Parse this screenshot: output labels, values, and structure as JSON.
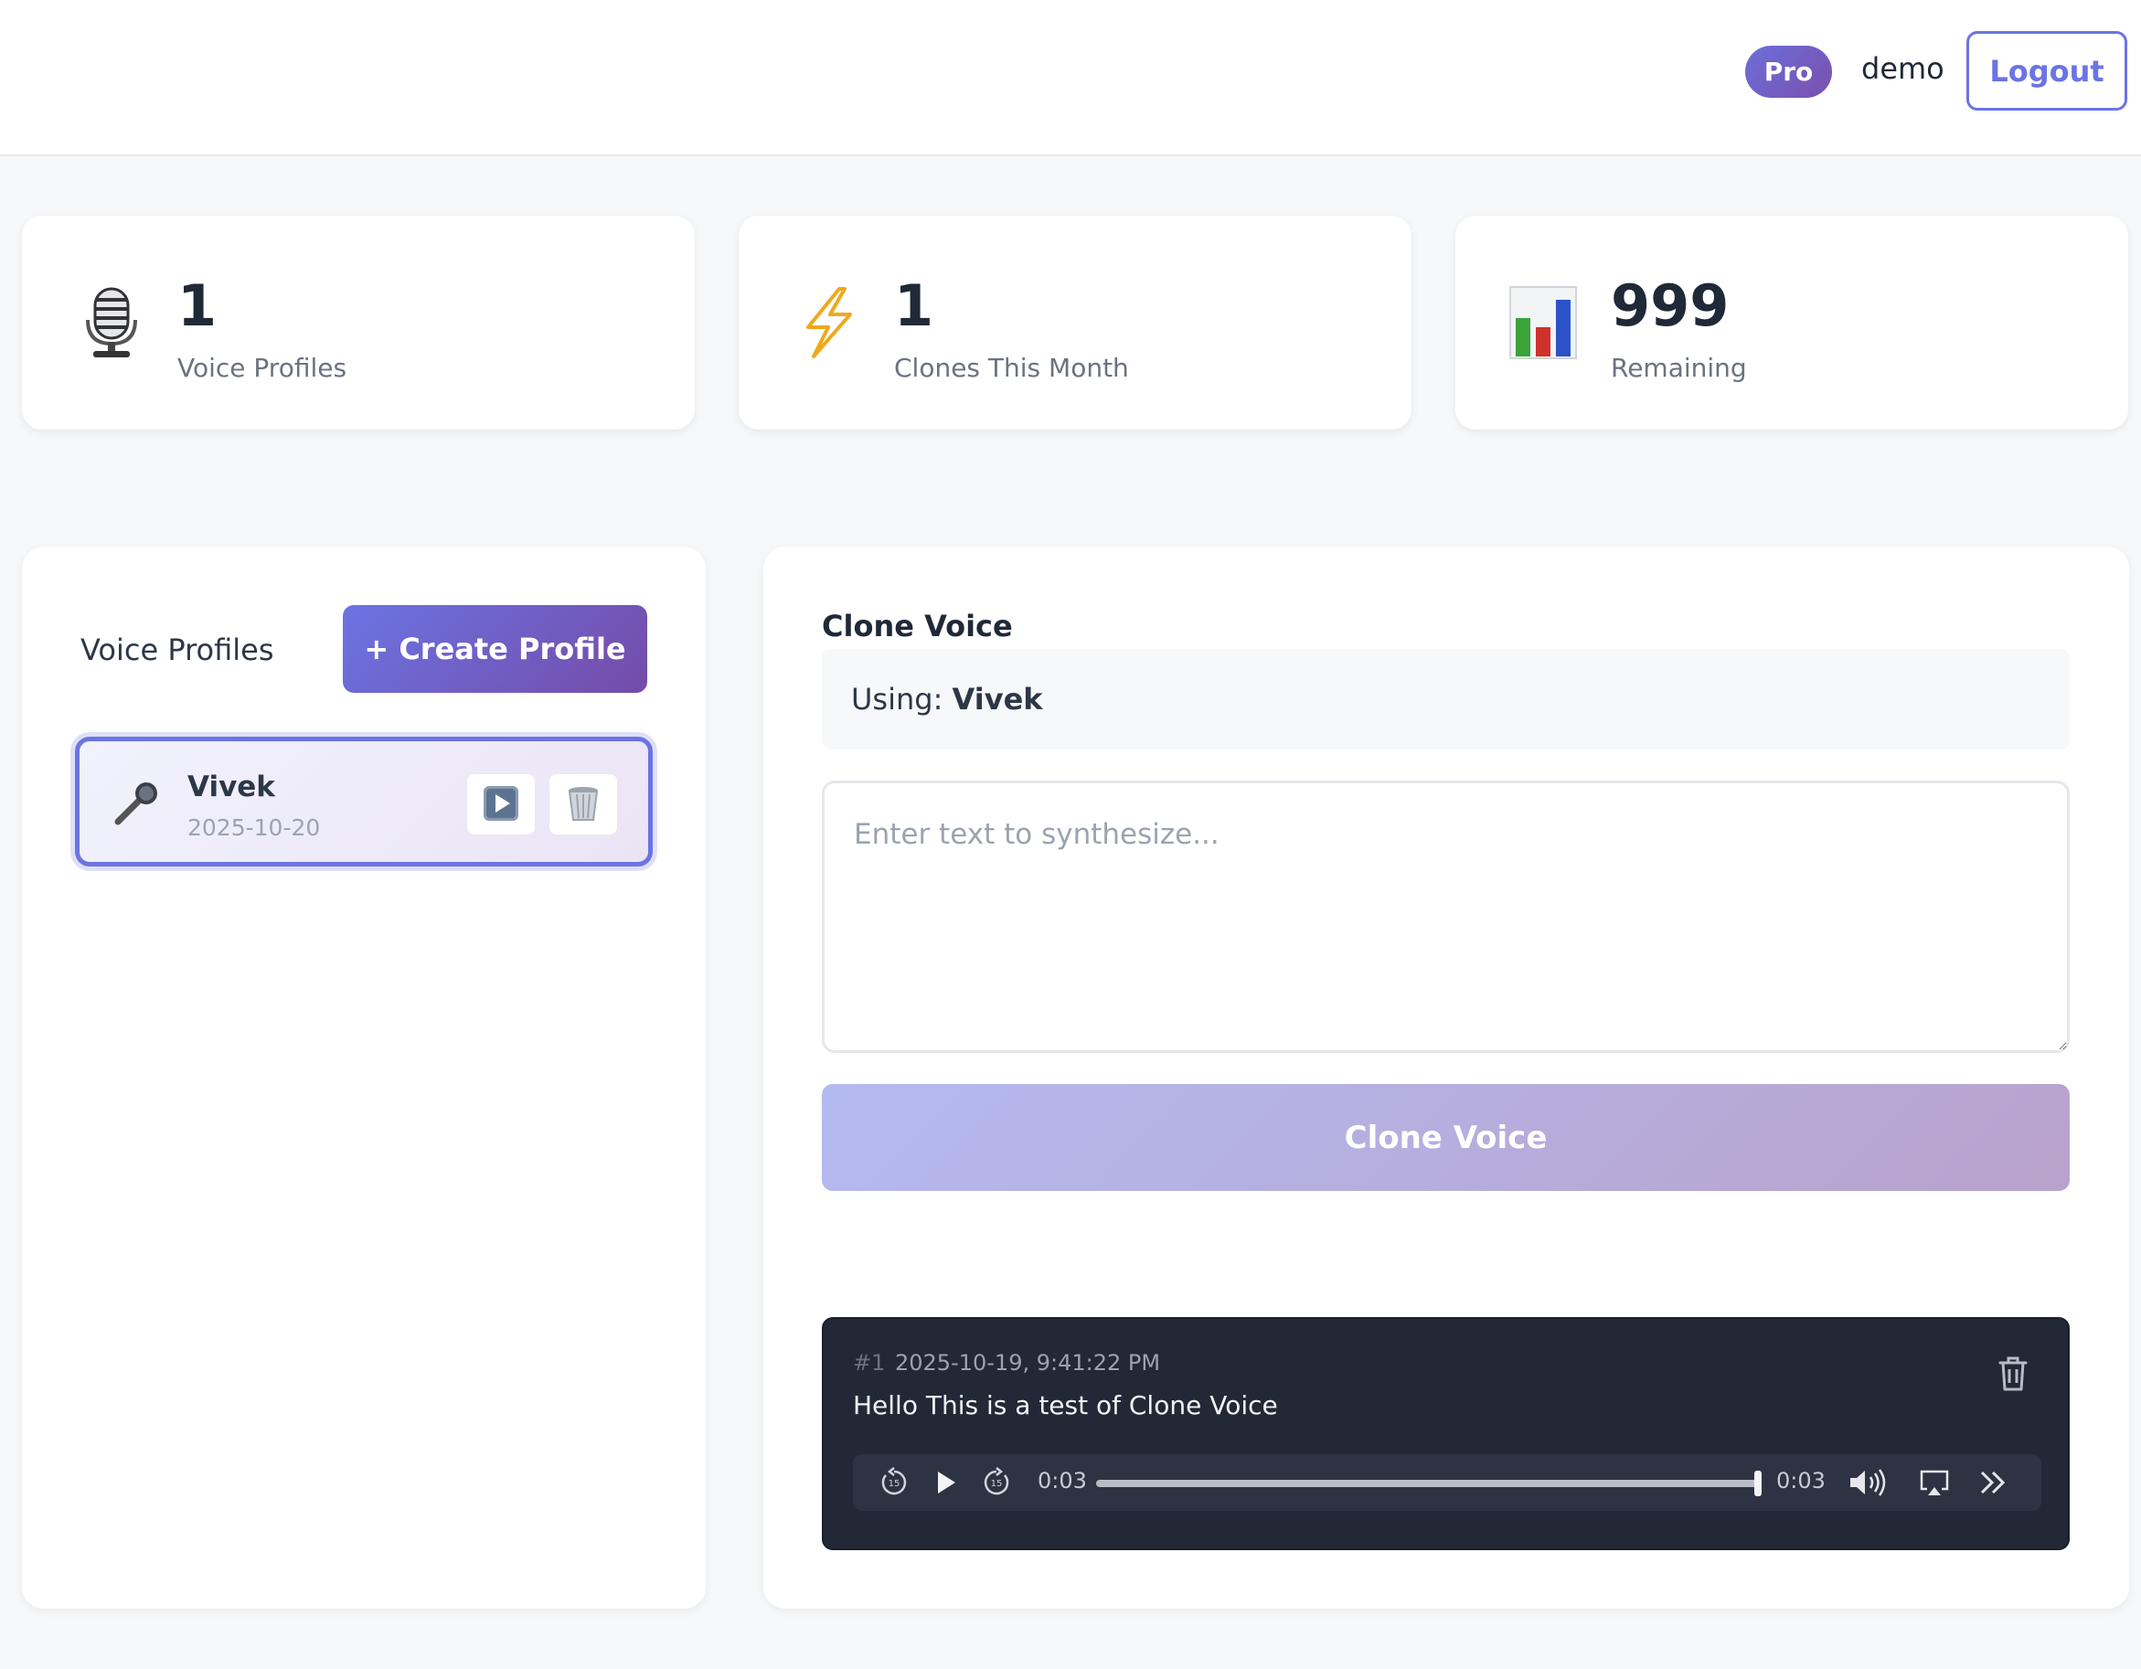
{
  "header": {
    "plan_badge": "Pro",
    "username": "demo",
    "logout_label": "Logout"
  },
  "stats": [
    {
      "icon": "studio-microphone-icon",
      "value": "1",
      "label": "Voice Profiles"
    },
    {
      "icon": "lightning-bolt-icon",
      "value": "1",
      "label": "Clones This Month"
    },
    {
      "icon": "bar-chart-icon",
      "value": "999",
      "label": "Remaining"
    }
  ],
  "profiles": {
    "title": "Voice Profiles",
    "create_label": "+ Create Profile",
    "items": [
      {
        "name": "Vivek",
        "date": "2025-10-20",
        "selected": true
      }
    ]
  },
  "clone": {
    "heading": "Clone Voice",
    "using_prefix": "Using:",
    "using_name": "Vivek",
    "textarea_placeholder": "Enter text to synthesize...",
    "textarea_value": "",
    "button_label": "Clone Voice"
  },
  "history": [
    {
      "number": "#1",
      "timestamp": "2025-10-19, 9:41:22 PM",
      "text": "Hello This is a test of Clone Voice",
      "player": {
        "current_time": "0:03",
        "duration": "0:03",
        "progress": 1.0
      }
    }
  ],
  "colors": {
    "accent": "#6b74e3",
    "accent_purple": "#754ba8",
    "history_bg": "#222836"
  }
}
